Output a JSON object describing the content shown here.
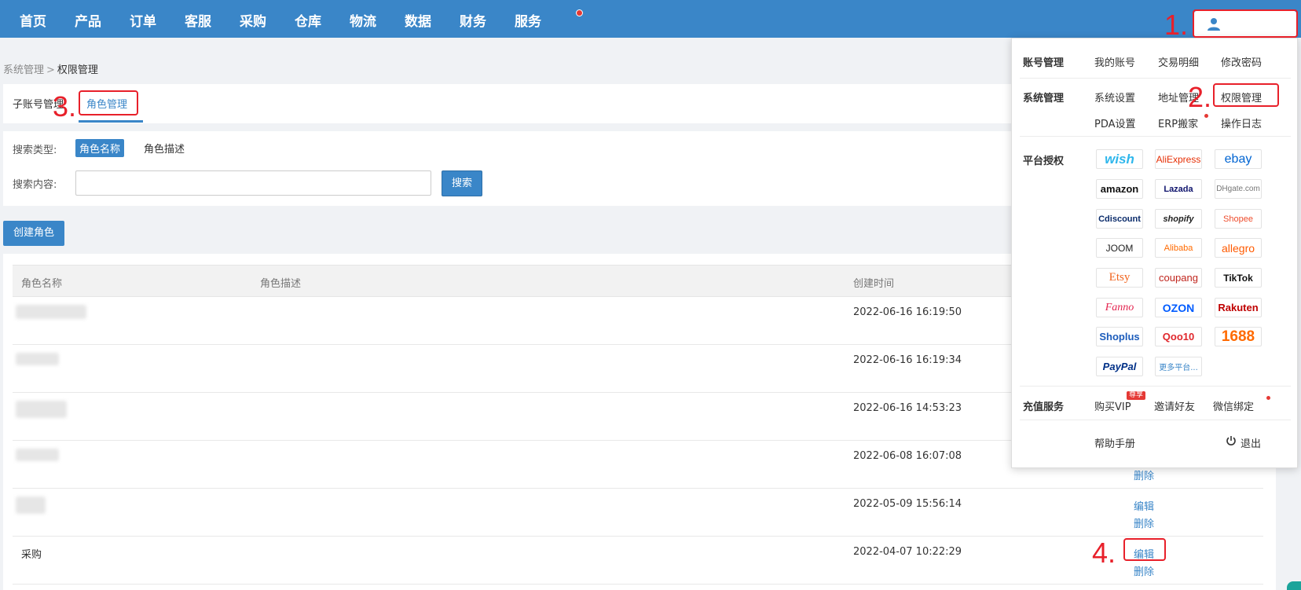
{
  "nav": {
    "items": [
      "首页",
      "产品",
      "订单",
      "客服",
      "采购",
      "仓库",
      "物流",
      "数据",
      "财务",
      "服务"
    ]
  },
  "user_menu": {
    "icon": "user-icon"
  },
  "steps": [
    "1.",
    "2.",
    "3.",
    "4."
  ],
  "breadcrumb": {
    "parent": "系统管理",
    "separator": ">",
    "current": "权限管理"
  },
  "tabs": [
    "子账号管理",
    "角色管理"
  ],
  "search": {
    "type_label": "搜索类型:",
    "types": [
      "角色名称",
      "角色描述"
    ],
    "content_label": "搜索内容:",
    "input_value": "",
    "button": "搜索"
  },
  "create_button": "创建角色",
  "table": {
    "headers": [
      "角色名称",
      "角色描述",
      "创建时间"
    ],
    "rows": [
      {
        "name": "",
        "time": "2022-06-16 16:19:50",
        "actions": []
      },
      {
        "name": "",
        "time": "2022-06-16 16:19:34",
        "actions": []
      },
      {
        "name": "",
        "time": "2022-06-16 14:53:23",
        "actions": []
      },
      {
        "name": "",
        "time": "2022-06-08 16:07:08",
        "actions": [
          "删除"
        ]
      },
      {
        "name": "",
        "time": "2022-05-09 15:56:14",
        "actions": [
          "编辑",
          "删除"
        ]
      },
      {
        "name": "采购",
        "time": "2022-04-07 10:22:29",
        "actions": [
          "编辑",
          "删除"
        ]
      }
    ]
  },
  "dropdown": {
    "account": {
      "title": "账号管理",
      "items": [
        "我的账号",
        "交易明细",
        "修改密码"
      ]
    },
    "system": {
      "title": "系统管理",
      "items": [
        "系统设置",
        "地址管理",
        "权限管理",
        "PDA设置",
        "ERP搬家",
        "操作日志"
      ]
    },
    "platform": {
      "title": "平台授权",
      "logos": [
        "wish",
        "AliExpress",
        "ebay",
        "amazon",
        "Lazada",
        "DHgate.com",
        "Cdiscount",
        "shopify",
        "Shopee",
        "JOOM",
        "Alibaba",
        "allegro",
        "Etsy",
        "coupang",
        "TikTok",
        "Fanno",
        "OZON",
        "Rakuten",
        "Shoplus",
        "Qoo10",
        "1688",
        "PayPal",
        "更多平台..."
      ]
    },
    "recharge": {
      "title": "充值服务",
      "items": [
        "购买VIP",
        "邀请好友",
        "微信绑定"
      ],
      "vip_badge": "尊享"
    },
    "help": "帮助手册",
    "logout": "退出"
  },
  "colors": {
    "primary": "#3a86c8",
    "annotation": "#e8202a"
  }
}
